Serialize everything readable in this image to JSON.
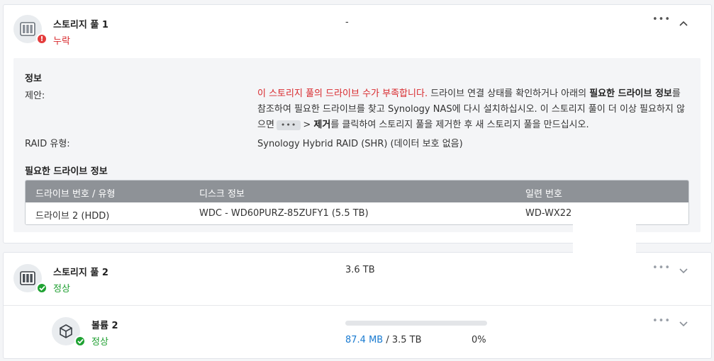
{
  "pool1": {
    "title": "스토리지 풀 1",
    "status": "누락",
    "size": "-",
    "more": "•••",
    "toggle": "^",
    "info": {
      "section_title": "정보",
      "suggestion_label": "제안:",
      "suggestion_red": "이 스토리지 풀의 드라이브 수가 부족합니다.",
      "suggestion_1": " 드라이브 연결 상태를 확인하거나 아래의 ",
      "suggestion_bold_1": "필요한 드라이브 정보",
      "suggestion_2": "를 참조하여 필요한 드라이브를 찾고 Synology NAS에 다시 설치하십시오. 이 스토리지 풀이 더 이상 필요하지 않으면",
      "suggestion_chip": "•••",
      "suggestion_3": "> ",
      "suggestion_bold_2": "제거",
      "suggestion_4": "를 클릭하여 스토리지 풀을 제거한 후 새 스토리지 풀을 만드십시오.",
      "raid_label": "RAID 유형:",
      "raid_value": "Synology Hybrid RAID (SHR) (데이터 보호 없음)"
    },
    "required_drives": {
      "section_title": "필요한 드라이브 정보",
      "columns": [
        "드라이브 번호 / 유형",
        "디스크 정보",
        "일련 번호"
      ],
      "rows": [
        [
          "드라이브 2 (HDD)",
          "WDC - WD60PURZ-85ZUFY1 (5.5 TB)",
          "WD-WX22"
        ]
      ]
    }
  },
  "pool2": {
    "title": "스토리지 풀 2",
    "status": "정상",
    "size": "3.6 TB",
    "more": "•••",
    "toggle": "⌄"
  },
  "volume2": {
    "title": "볼륨 2",
    "status": "정상",
    "used": "87.4 MB",
    "total": " / 3.5 TB",
    "percent": "0%",
    "progress_fraction": 0.0,
    "more": "•••",
    "toggle": "⌄"
  },
  "colors": {
    "error": "#e43c3c",
    "ok": "#1fa232",
    "link_blue": "#1a7bd1",
    "table_header": "#8e9297"
  },
  "icons": {
    "pool_icon": "storage-pool-icon",
    "volume_icon": "volume-cube-icon",
    "error_badge": "exclamation-icon",
    "ok_badge": "checkmark-icon"
  }
}
